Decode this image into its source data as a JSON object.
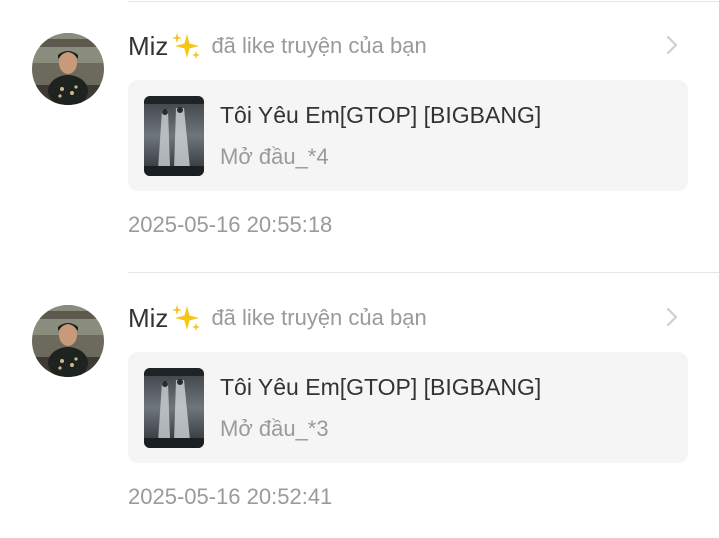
{
  "notifications": [
    {
      "user": "Miz",
      "user_icon": "sparkles-icon",
      "action": "đã like truyện của bạn",
      "story_title": "Tôi Yêu Em[GTOP] [BIGBANG]",
      "chapter": "Mở đầu_*4",
      "timestamp": "2025-05-16 20:55:18"
    },
    {
      "user": "Miz",
      "user_icon": "sparkles-icon",
      "action": "đã like truyện của bạn",
      "story_title": "Tôi Yêu Em[GTOP] [BIGBANG]",
      "chapter": "Mở đầu_*3",
      "timestamp": "2025-05-16 20:52:41"
    }
  ],
  "colors": {
    "card_background": "#f5f5f5",
    "secondary_text": "#9a9a9a",
    "primary_text": "#333333",
    "sparkle": "#f5c518"
  }
}
